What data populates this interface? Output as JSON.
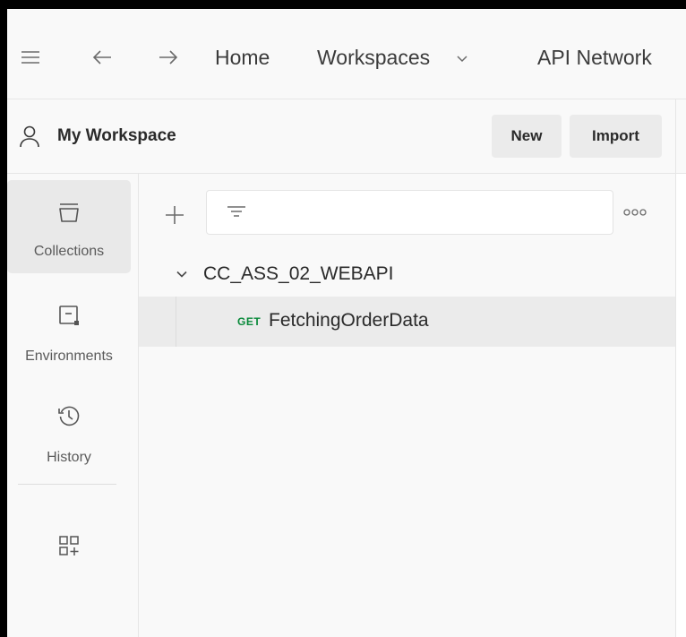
{
  "topbar": {
    "home_label": "Home",
    "workspaces_label": "Workspaces",
    "api_network_label": "API Network"
  },
  "workspace": {
    "title": "My Workspace",
    "new_label": "New",
    "import_label": "Import"
  },
  "rail": {
    "items": [
      {
        "label": "Collections",
        "icon": "collections-icon",
        "active": true
      },
      {
        "label": "Environments",
        "icon": "environments-icon",
        "active": false
      },
      {
        "label": "History",
        "icon": "history-icon",
        "active": false
      }
    ],
    "configure_icon": "apps-plus-icon"
  },
  "collections": {
    "items": [
      {
        "name": "CC_ASS_02_WEBAPI",
        "expanded": true,
        "requests": [
          {
            "method": "GET",
            "name": "FetchingOrderData",
            "selected": true
          }
        ]
      }
    ]
  },
  "colors": {
    "get_method": "#0a8a3b",
    "sidebar_bg": "#f9f9f9",
    "active_item_bg": "#e9e9e9"
  }
}
